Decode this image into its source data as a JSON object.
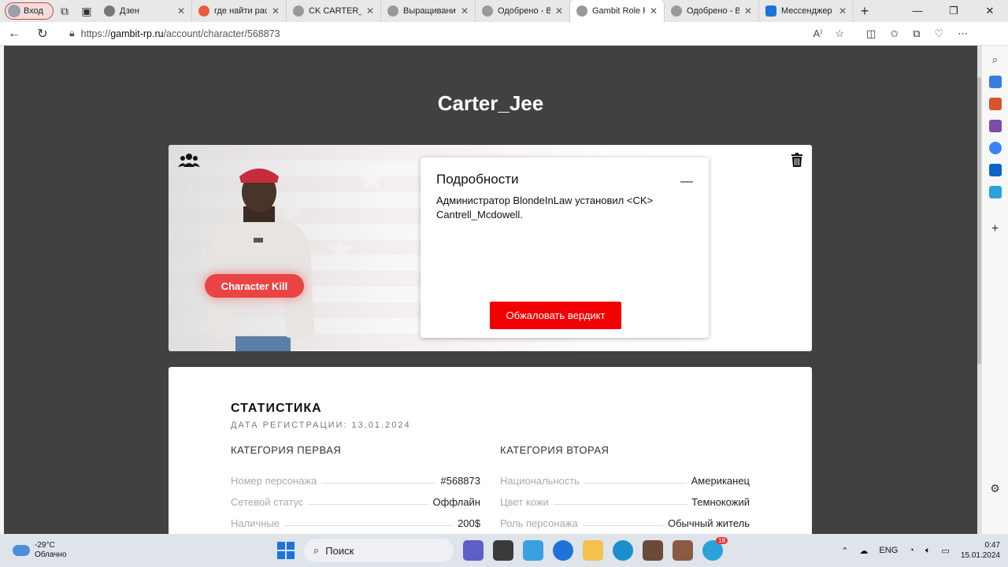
{
  "browser": {
    "profile_label": "Вход",
    "tabs": [
      {
        "title": "Дзен",
        "color": "#777777"
      },
      {
        "title": "где найти раст",
        "color": "#e85d3f"
      },
      {
        "title": "CK CARTER_M",
        "color": "#999999"
      },
      {
        "title": "Выращивание",
        "color": "#999999"
      },
      {
        "title": "Одобрено - Bl",
        "color": "#999999"
      },
      {
        "title": "Gambit Role Pl",
        "color": "#999999"
      },
      {
        "title": "Одобрено - Bl",
        "color": "#999999"
      },
      {
        "title": "Мессенджер",
        "color": "#1e73d8"
      }
    ],
    "url_prefix": "https://",
    "url_host": "gambit-rp.ru",
    "url_path": "/account/character/568873"
  },
  "page": {
    "character_name": "Carter_Jee",
    "status_pill": "Character Kill",
    "details": {
      "title": "Подробности",
      "collapse_glyph": "—",
      "text": "Администратор BlondeInLaw установил <CK> Cantrell_Mcdowell.",
      "appeal_label": "Обжаловать вердикт"
    },
    "stats": {
      "title": "СТАТИСТИКА",
      "registration": "ДАТА РЕГИСТРАЦИИ: 13.01.2024",
      "category_one": {
        "title": "КАТЕГОРИЯ ПЕРВАЯ",
        "rows": [
          {
            "label": "Номер персонажа",
            "value": "#568873"
          },
          {
            "label": "Сетевой статус",
            "value": "Оффлайн"
          },
          {
            "label": "Наличные",
            "value": "200$"
          }
        ]
      },
      "category_two": {
        "title": "КАТЕГОРИЯ ВТОРАЯ",
        "rows": [
          {
            "label": "Национальность",
            "value": "Американец"
          },
          {
            "label": "Цвет кожи",
            "value": "Темнокожий"
          },
          {
            "label": "Роль персонажа",
            "value": "Обычный житель"
          }
        ]
      }
    }
  },
  "taskbar": {
    "temperature": "-29°C",
    "weather": "Облачно",
    "search_label": "Поиск",
    "language": "ENG",
    "time": "0:47",
    "date": "15.01.2024",
    "telegram_badge": "18"
  },
  "colors": {
    "page_bg": "#414141",
    "accent_red": "#f00000",
    "pill_red": "#e94545"
  }
}
